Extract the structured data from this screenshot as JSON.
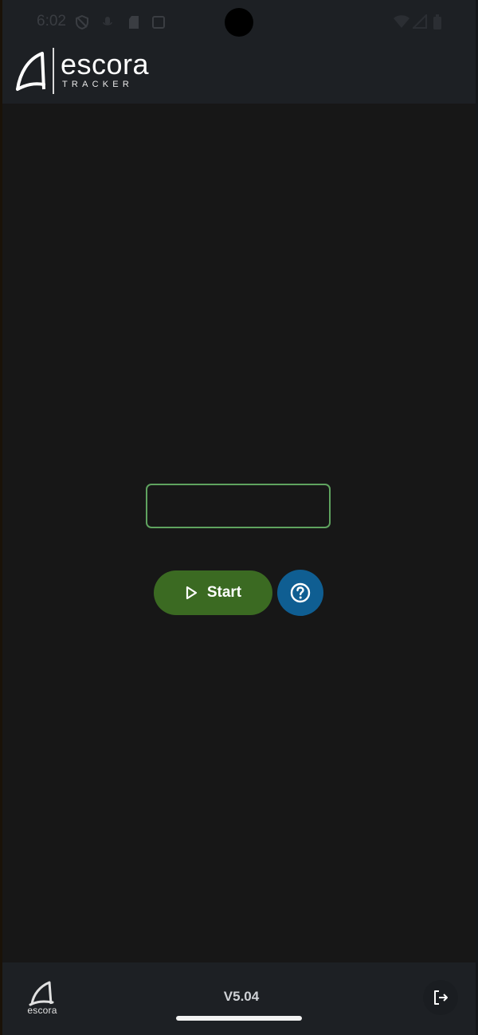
{
  "status_bar": {
    "time": "6:02"
  },
  "header": {
    "brand_name": "escora",
    "brand_sub": "TRACKER"
  },
  "main": {
    "code_input": {
      "value": "",
      "placeholder": ""
    },
    "start_button_label": "Start"
  },
  "footer": {
    "logo_text": "escora",
    "version": "V5.04"
  },
  "colors": {
    "background": "#171717",
    "header": "#1d2024",
    "start_button": "#3b6a22",
    "help_button": "#0f5e92",
    "input_border": "#5fa35f"
  },
  "icons": {
    "brand": "escora-sail-logo-icon",
    "start": "play-outline-icon",
    "help": "question-circle-icon",
    "logout": "logout-icon"
  }
}
